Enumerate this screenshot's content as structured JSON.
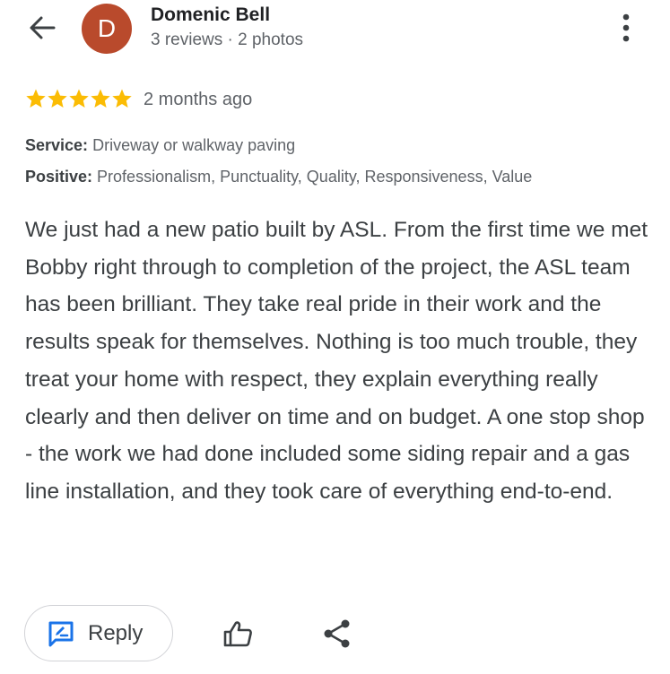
{
  "reviewer": {
    "initial": "D",
    "avatar_color": "#b94a2c",
    "name": "Domenic Bell",
    "meta": "3 reviews · 2 photos"
  },
  "rating": {
    "stars": 5,
    "star_color": "#fbbc04",
    "time_ago": "2 months ago"
  },
  "details": {
    "service_label": "Service:",
    "service_value": "Driveway or walkway paving",
    "positive_label": "Positive:",
    "positive_value": "Professionalism, Punctuality, Quality, Responsiveness, Value"
  },
  "review_text": "We just had a new patio built by ASL. From the first time we met Bobby right through to completion of the project, the ASL team has been brilliant. They take real pride in their work and the results speak for themselves. Nothing is too much trouble, they treat your home with respect, they explain everything really clearly and then deliver on time and on budget. A one stop shop - the work we had done included some siding repair and a gas line installation, and they took care of everything end-to-end.",
  "actions": {
    "reply_label": "Reply",
    "reply_icon": "reply-icon",
    "like_icon": "thumb-up-icon",
    "share_icon": "share-icon",
    "accent": "#1a73e8"
  },
  "header_icons": {
    "back": "back-arrow-icon",
    "more": "more-vert-icon"
  }
}
